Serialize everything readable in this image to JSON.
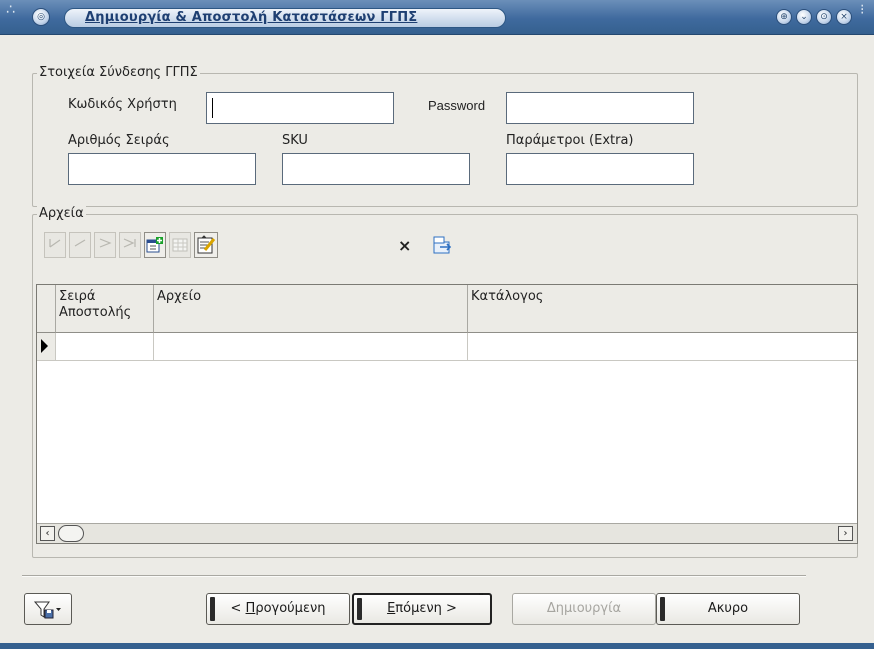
{
  "window": {
    "title": "Δημιουργία & Αποστολή Καταστάσεων ΓΓΠΣ",
    "system_buttons": [
      "help-icon",
      "minimize-icon",
      "restore-icon",
      "close-icon"
    ]
  },
  "connection": {
    "legend": "Στοιχεία Σύνδεσης ΓΓΠΣ",
    "user_code_label": "Κωδικός Χρήστη",
    "user_code_value": "",
    "password_label": "Password",
    "password_value": "",
    "serial_label": "Αριθμός Σειράς",
    "serial_value": "",
    "sku_label": "SKU",
    "sku_value": "",
    "params_label": "Παράμετροι (Extra)",
    "params_value": ""
  },
  "files": {
    "legend": "Αρχεία",
    "toolbar": [
      "first-record-icon",
      "previous-record-icon",
      "next-record-icon",
      "last-record-icon",
      "add-record-icon",
      "grid-view-icon",
      "edit-notes-icon"
    ],
    "delete_symbol": "×",
    "columns": [
      "Σειρά Αποστολής",
      "Αρχείο",
      "Κατάλογος"
    ],
    "rows": [
      [
        "",
        "",
        ""
      ]
    ],
    "scroll_left": "‹",
    "scroll_right": "›"
  },
  "footer": {
    "filter_menu_icon": "filter-save-icon",
    "prev_prefix": "< ",
    "prev_hotkey": "Π",
    "prev_rest": "ρογούμενη",
    "next_hotkey": "Ε",
    "next_rest": "πόμενη >",
    "create_label": "Δημιουργία",
    "cancel_label": "Ακυρο"
  },
  "colors": {
    "titlebar": "#3f6a9e",
    "window_bg": "#ecebe6",
    "title_text": "#1e3f72"
  }
}
